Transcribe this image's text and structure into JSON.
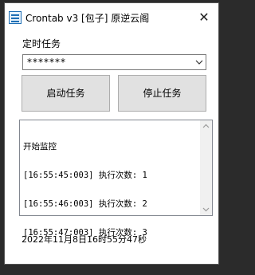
{
  "window": {
    "title": "Crontab v3 [包子] 原逆云阁",
    "close_glyph": "✕"
  },
  "task": {
    "label": "定时任务",
    "selected_value": "*******"
  },
  "buttons": {
    "start_label": "启动任务",
    "stop_label": "停止任务"
  },
  "log": {
    "lines": [
      "开始监控",
      "[16:55:45:003] 执行次数: 1",
      "[16:55:46:003] 执行次数: 2",
      "[16:55:47:003] 执行次数: 3"
    ]
  },
  "status": {
    "datetime": "2022年11月8日16时55分47秒"
  },
  "icons": {
    "app": "app-icon",
    "close": "close-icon",
    "dropdown": "chevron-down-icon",
    "scroll_up": "scroll-up-icon",
    "scroll_down": "scroll-down-icon"
  },
  "colors": {
    "button_bg": "#e1e1e1",
    "window_bg": "#ffffff",
    "backdrop": "#2b2b2b"
  }
}
